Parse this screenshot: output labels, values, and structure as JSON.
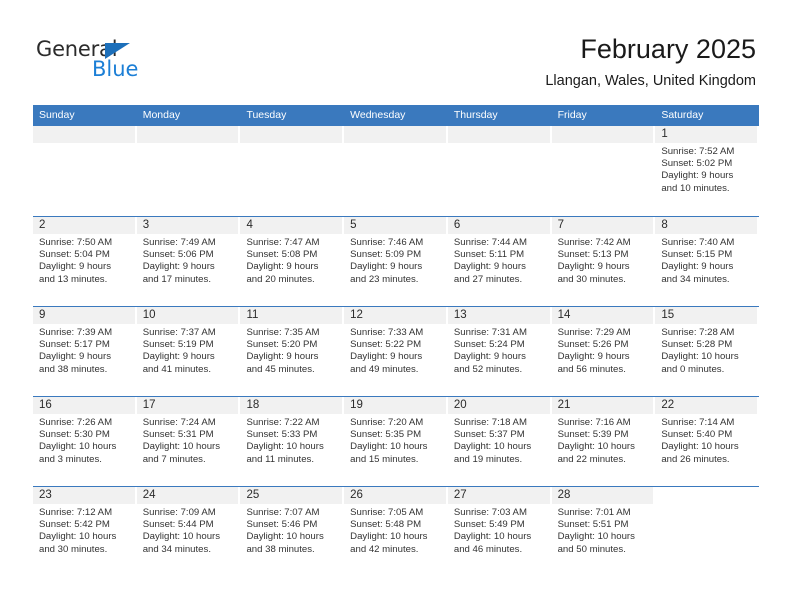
{
  "brand": {
    "name_top": "General",
    "name_bottom": "Blue",
    "triangle_color": "#1c6fba",
    "blue_text_color": "#1c7fd6"
  },
  "header": {
    "title": "February 2025",
    "subtitle": "Llangan, Wales, United Kingdom"
  },
  "theme": {
    "header_bar_color": "#3a79be",
    "row_divider_color": "#3a79be",
    "day_band_color": "#f1f1f1"
  },
  "weekdays": [
    "Sunday",
    "Monday",
    "Tuesday",
    "Wednesday",
    "Thursday",
    "Friday",
    "Saturday"
  ],
  "weeks": [
    [
      {
        "day": "",
        "empty": true
      },
      {
        "day": "",
        "empty": true
      },
      {
        "day": "",
        "empty": true
      },
      {
        "day": "",
        "empty": true
      },
      {
        "day": "",
        "empty": true
      },
      {
        "day": "",
        "empty": true
      },
      {
        "day": "1",
        "sunrise": "Sunrise: 7:52 AM",
        "sunset": "Sunset: 5:02 PM",
        "daylight_line1": "Daylight: 9 hours",
        "daylight_line2": "and 10 minutes."
      }
    ],
    [
      {
        "day": "2",
        "sunrise": "Sunrise: 7:50 AM",
        "sunset": "Sunset: 5:04 PM",
        "daylight_line1": "Daylight: 9 hours",
        "daylight_line2": "and 13 minutes."
      },
      {
        "day": "3",
        "sunrise": "Sunrise: 7:49 AM",
        "sunset": "Sunset: 5:06 PM",
        "daylight_line1": "Daylight: 9 hours",
        "daylight_line2": "and 17 minutes."
      },
      {
        "day": "4",
        "sunrise": "Sunrise: 7:47 AM",
        "sunset": "Sunset: 5:08 PM",
        "daylight_line1": "Daylight: 9 hours",
        "daylight_line2": "and 20 minutes."
      },
      {
        "day": "5",
        "sunrise": "Sunrise: 7:46 AM",
        "sunset": "Sunset: 5:09 PM",
        "daylight_line1": "Daylight: 9 hours",
        "daylight_line2": "and 23 minutes."
      },
      {
        "day": "6",
        "sunrise": "Sunrise: 7:44 AM",
        "sunset": "Sunset: 5:11 PM",
        "daylight_line1": "Daylight: 9 hours",
        "daylight_line2": "and 27 minutes."
      },
      {
        "day": "7",
        "sunrise": "Sunrise: 7:42 AM",
        "sunset": "Sunset: 5:13 PM",
        "daylight_line1": "Daylight: 9 hours",
        "daylight_line2": "and 30 minutes."
      },
      {
        "day": "8",
        "sunrise": "Sunrise: 7:40 AM",
        "sunset": "Sunset: 5:15 PM",
        "daylight_line1": "Daylight: 9 hours",
        "daylight_line2": "and 34 minutes."
      }
    ],
    [
      {
        "day": "9",
        "sunrise": "Sunrise: 7:39 AM",
        "sunset": "Sunset: 5:17 PM",
        "daylight_line1": "Daylight: 9 hours",
        "daylight_line2": "and 38 minutes."
      },
      {
        "day": "10",
        "sunrise": "Sunrise: 7:37 AM",
        "sunset": "Sunset: 5:19 PM",
        "daylight_line1": "Daylight: 9 hours",
        "daylight_line2": "and 41 minutes."
      },
      {
        "day": "11",
        "sunrise": "Sunrise: 7:35 AM",
        "sunset": "Sunset: 5:20 PM",
        "daylight_line1": "Daylight: 9 hours",
        "daylight_line2": "and 45 minutes."
      },
      {
        "day": "12",
        "sunrise": "Sunrise: 7:33 AM",
        "sunset": "Sunset: 5:22 PM",
        "daylight_line1": "Daylight: 9 hours",
        "daylight_line2": "and 49 minutes."
      },
      {
        "day": "13",
        "sunrise": "Sunrise: 7:31 AM",
        "sunset": "Sunset: 5:24 PM",
        "daylight_line1": "Daylight: 9 hours",
        "daylight_line2": "and 52 minutes."
      },
      {
        "day": "14",
        "sunrise": "Sunrise: 7:29 AM",
        "sunset": "Sunset: 5:26 PM",
        "daylight_line1": "Daylight: 9 hours",
        "daylight_line2": "and 56 minutes."
      },
      {
        "day": "15",
        "sunrise": "Sunrise: 7:28 AM",
        "sunset": "Sunset: 5:28 PM",
        "daylight_line1": "Daylight: 10 hours",
        "daylight_line2": "and 0 minutes."
      }
    ],
    [
      {
        "day": "16",
        "sunrise": "Sunrise: 7:26 AM",
        "sunset": "Sunset: 5:30 PM",
        "daylight_line1": "Daylight: 10 hours",
        "daylight_line2": "and 3 minutes."
      },
      {
        "day": "17",
        "sunrise": "Sunrise: 7:24 AM",
        "sunset": "Sunset: 5:31 PM",
        "daylight_line1": "Daylight: 10 hours",
        "daylight_line2": "and 7 minutes."
      },
      {
        "day": "18",
        "sunrise": "Sunrise: 7:22 AM",
        "sunset": "Sunset: 5:33 PM",
        "daylight_line1": "Daylight: 10 hours",
        "daylight_line2": "and 11 minutes."
      },
      {
        "day": "19",
        "sunrise": "Sunrise: 7:20 AM",
        "sunset": "Sunset: 5:35 PM",
        "daylight_line1": "Daylight: 10 hours",
        "daylight_line2": "and 15 minutes."
      },
      {
        "day": "20",
        "sunrise": "Sunrise: 7:18 AM",
        "sunset": "Sunset: 5:37 PM",
        "daylight_line1": "Daylight: 10 hours",
        "daylight_line2": "and 19 minutes."
      },
      {
        "day": "21",
        "sunrise": "Sunrise: 7:16 AM",
        "sunset": "Sunset: 5:39 PM",
        "daylight_line1": "Daylight: 10 hours",
        "daylight_line2": "and 22 minutes."
      },
      {
        "day": "22",
        "sunrise": "Sunrise: 7:14 AM",
        "sunset": "Sunset: 5:40 PM",
        "daylight_line1": "Daylight: 10 hours",
        "daylight_line2": "and 26 minutes."
      }
    ],
    [
      {
        "day": "23",
        "sunrise": "Sunrise: 7:12 AM",
        "sunset": "Sunset: 5:42 PM",
        "daylight_line1": "Daylight: 10 hours",
        "daylight_line2": "and 30 minutes."
      },
      {
        "day": "24",
        "sunrise": "Sunrise: 7:09 AM",
        "sunset": "Sunset: 5:44 PM",
        "daylight_line1": "Daylight: 10 hours",
        "daylight_line2": "and 34 minutes."
      },
      {
        "day": "25",
        "sunrise": "Sunrise: 7:07 AM",
        "sunset": "Sunset: 5:46 PM",
        "daylight_line1": "Daylight: 10 hours",
        "daylight_line2": "and 38 minutes."
      },
      {
        "day": "26",
        "sunrise": "Sunrise: 7:05 AM",
        "sunset": "Sunset: 5:48 PM",
        "daylight_line1": "Daylight: 10 hours",
        "daylight_line2": "and 42 minutes."
      },
      {
        "day": "27",
        "sunrise": "Sunrise: 7:03 AM",
        "sunset": "Sunset: 5:49 PM",
        "daylight_line1": "Daylight: 10 hours",
        "daylight_line2": "and 46 minutes."
      },
      {
        "day": "28",
        "sunrise": "Sunrise: 7:01 AM",
        "sunset": "Sunset: 5:51 PM",
        "daylight_line1": "Daylight: 10 hours",
        "daylight_line2": "and 50 minutes."
      },
      {
        "day": "",
        "empty": true,
        "no_band": true
      }
    ]
  ]
}
